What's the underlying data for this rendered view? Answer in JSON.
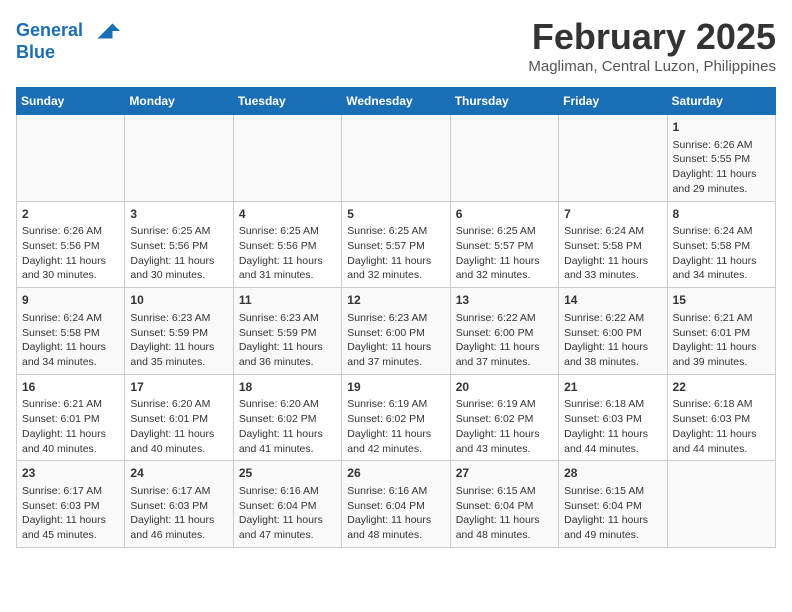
{
  "header": {
    "logo_line1": "General",
    "logo_line2": "Blue",
    "month": "February 2025",
    "location": "Magliman, Central Luzon, Philippines"
  },
  "weekdays": [
    "Sunday",
    "Monday",
    "Tuesday",
    "Wednesday",
    "Thursday",
    "Friday",
    "Saturday"
  ],
  "weeks": [
    [
      {
        "day": "",
        "info": ""
      },
      {
        "day": "",
        "info": ""
      },
      {
        "day": "",
        "info": ""
      },
      {
        "day": "",
        "info": ""
      },
      {
        "day": "",
        "info": ""
      },
      {
        "day": "",
        "info": ""
      },
      {
        "day": "1",
        "info": "Sunrise: 6:26 AM\nSunset: 5:55 PM\nDaylight: 11 hours and 29 minutes."
      }
    ],
    [
      {
        "day": "2",
        "info": "Sunrise: 6:26 AM\nSunset: 5:56 PM\nDaylight: 11 hours and 30 minutes."
      },
      {
        "day": "3",
        "info": "Sunrise: 6:25 AM\nSunset: 5:56 PM\nDaylight: 11 hours and 30 minutes."
      },
      {
        "day": "4",
        "info": "Sunrise: 6:25 AM\nSunset: 5:56 PM\nDaylight: 11 hours and 31 minutes."
      },
      {
        "day": "5",
        "info": "Sunrise: 6:25 AM\nSunset: 5:57 PM\nDaylight: 11 hours and 32 minutes."
      },
      {
        "day": "6",
        "info": "Sunrise: 6:25 AM\nSunset: 5:57 PM\nDaylight: 11 hours and 32 minutes."
      },
      {
        "day": "7",
        "info": "Sunrise: 6:24 AM\nSunset: 5:58 PM\nDaylight: 11 hours and 33 minutes."
      },
      {
        "day": "8",
        "info": "Sunrise: 6:24 AM\nSunset: 5:58 PM\nDaylight: 11 hours and 34 minutes."
      }
    ],
    [
      {
        "day": "9",
        "info": "Sunrise: 6:24 AM\nSunset: 5:58 PM\nDaylight: 11 hours and 34 minutes."
      },
      {
        "day": "10",
        "info": "Sunrise: 6:23 AM\nSunset: 5:59 PM\nDaylight: 11 hours and 35 minutes."
      },
      {
        "day": "11",
        "info": "Sunrise: 6:23 AM\nSunset: 5:59 PM\nDaylight: 11 hours and 36 minutes."
      },
      {
        "day": "12",
        "info": "Sunrise: 6:23 AM\nSunset: 6:00 PM\nDaylight: 11 hours and 37 minutes."
      },
      {
        "day": "13",
        "info": "Sunrise: 6:22 AM\nSunset: 6:00 PM\nDaylight: 11 hours and 37 minutes."
      },
      {
        "day": "14",
        "info": "Sunrise: 6:22 AM\nSunset: 6:00 PM\nDaylight: 11 hours and 38 minutes."
      },
      {
        "day": "15",
        "info": "Sunrise: 6:21 AM\nSunset: 6:01 PM\nDaylight: 11 hours and 39 minutes."
      }
    ],
    [
      {
        "day": "16",
        "info": "Sunrise: 6:21 AM\nSunset: 6:01 PM\nDaylight: 11 hours and 40 minutes."
      },
      {
        "day": "17",
        "info": "Sunrise: 6:20 AM\nSunset: 6:01 PM\nDaylight: 11 hours and 40 minutes."
      },
      {
        "day": "18",
        "info": "Sunrise: 6:20 AM\nSunset: 6:02 PM\nDaylight: 11 hours and 41 minutes."
      },
      {
        "day": "19",
        "info": "Sunrise: 6:19 AM\nSunset: 6:02 PM\nDaylight: 11 hours and 42 minutes."
      },
      {
        "day": "20",
        "info": "Sunrise: 6:19 AM\nSunset: 6:02 PM\nDaylight: 11 hours and 43 minutes."
      },
      {
        "day": "21",
        "info": "Sunrise: 6:18 AM\nSunset: 6:03 PM\nDaylight: 11 hours and 44 minutes."
      },
      {
        "day": "22",
        "info": "Sunrise: 6:18 AM\nSunset: 6:03 PM\nDaylight: 11 hours and 44 minutes."
      }
    ],
    [
      {
        "day": "23",
        "info": "Sunrise: 6:17 AM\nSunset: 6:03 PM\nDaylight: 11 hours and 45 minutes."
      },
      {
        "day": "24",
        "info": "Sunrise: 6:17 AM\nSunset: 6:03 PM\nDaylight: 11 hours and 46 minutes."
      },
      {
        "day": "25",
        "info": "Sunrise: 6:16 AM\nSunset: 6:04 PM\nDaylight: 11 hours and 47 minutes."
      },
      {
        "day": "26",
        "info": "Sunrise: 6:16 AM\nSunset: 6:04 PM\nDaylight: 11 hours and 48 minutes."
      },
      {
        "day": "27",
        "info": "Sunrise: 6:15 AM\nSunset: 6:04 PM\nDaylight: 11 hours and 48 minutes."
      },
      {
        "day": "28",
        "info": "Sunrise: 6:15 AM\nSunset: 6:04 PM\nDaylight: 11 hours and 49 minutes."
      },
      {
        "day": "",
        "info": ""
      }
    ]
  ]
}
